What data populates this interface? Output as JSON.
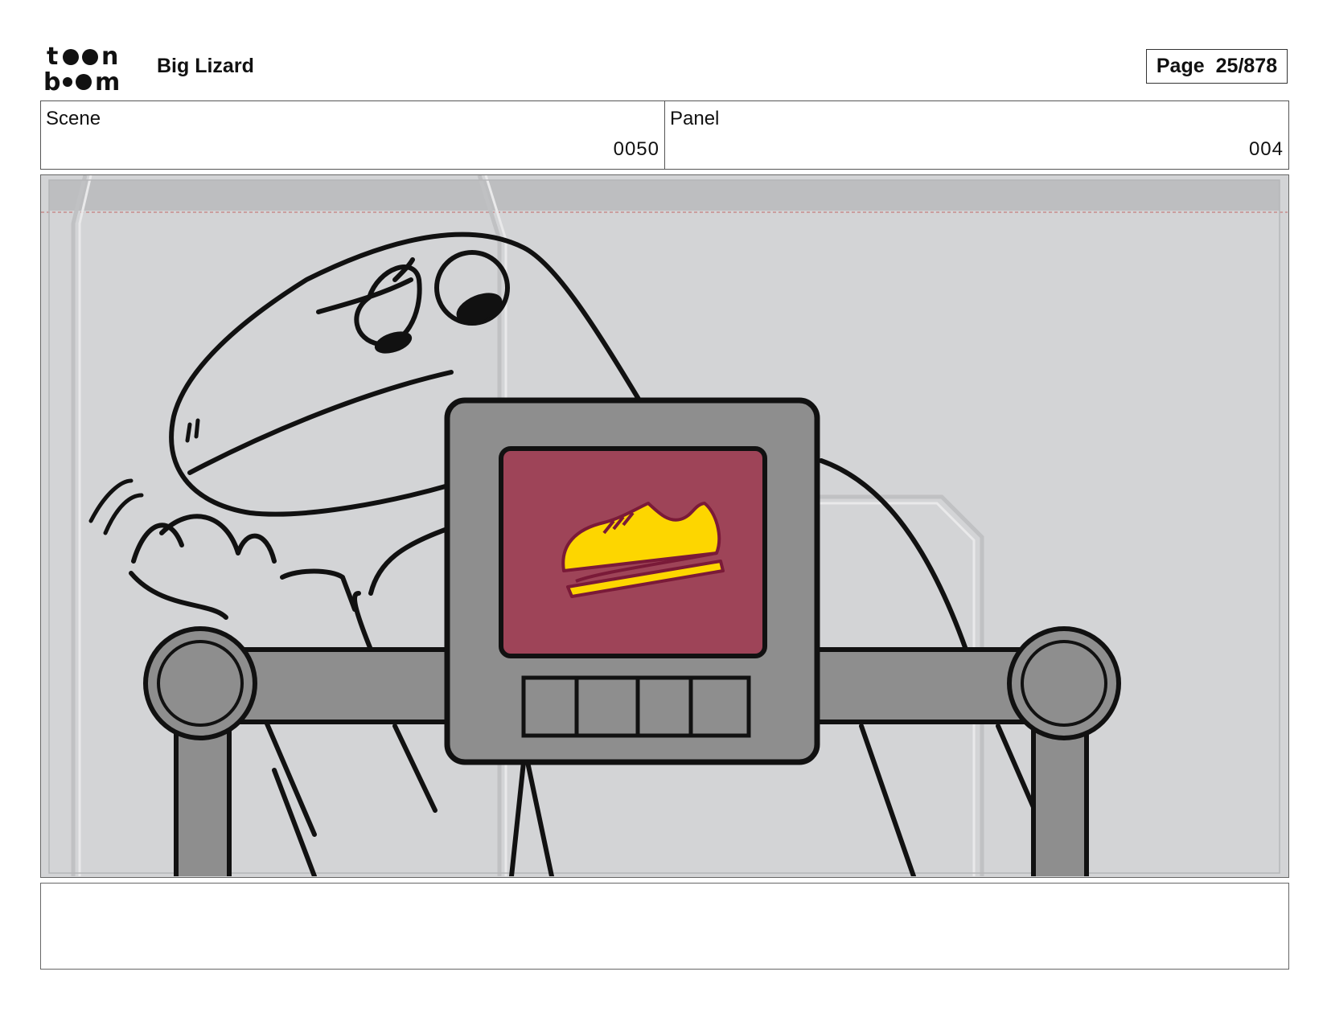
{
  "header": {
    "logo_text": "toon boom",
    "project_title": "Big Lizard",
    "page_label": "Page",
    "page_number": "25/878"
  },
  "meta": {
    "scene_label": "Scene",
    "scene_value": "0050",
    "panel_label": "Panel",
    "panel_value": "004"
  },
  "panel": {
    "screen_color": "#9e4458",
    "shoe_color": "#fdd600",
    "console_color": "#8e8e8e"
  },
  "notes": {
    "text": ""
  }
}
